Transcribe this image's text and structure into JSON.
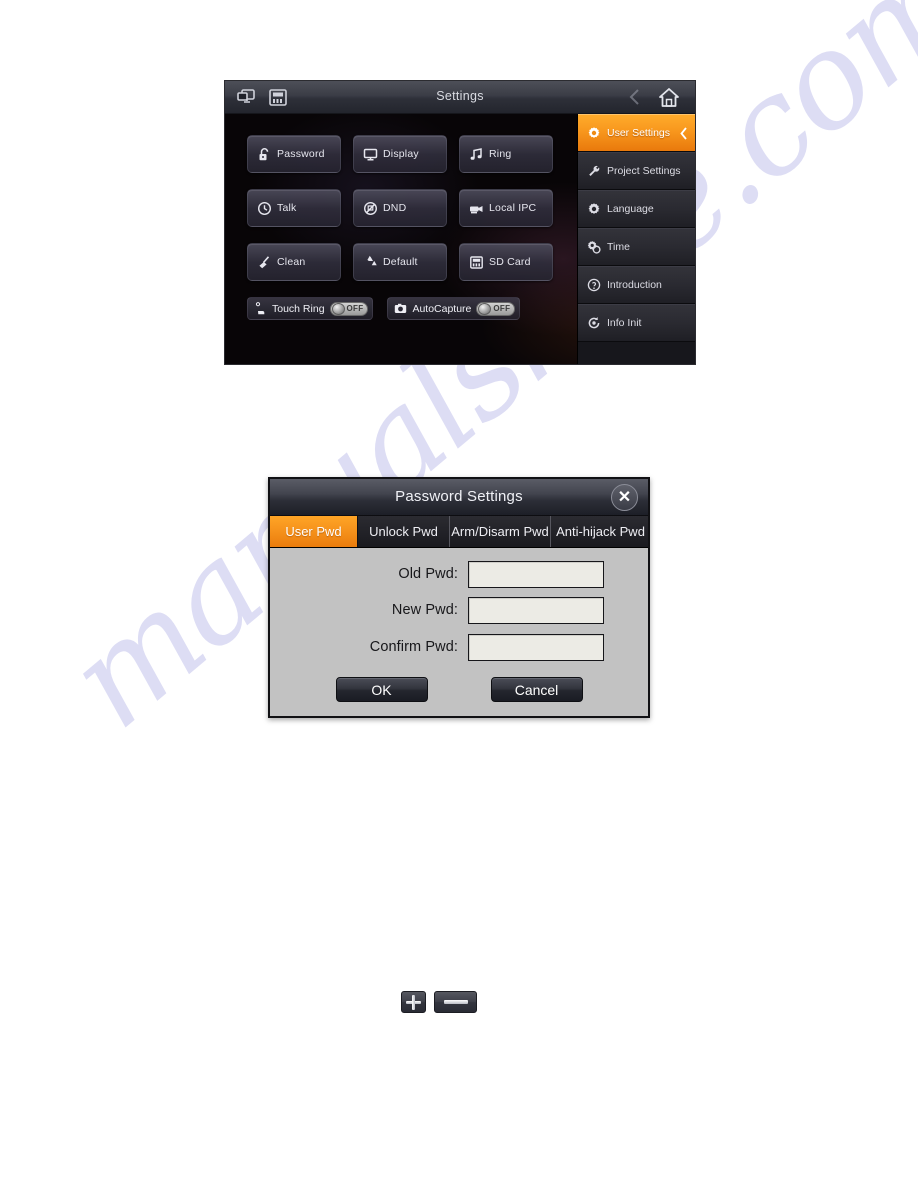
{
  "watermark": {
    "text": "manualshive.com"
  },
  "device": {
    "titlebar": {
      "title": "Settings",
      "left_icons": [
        {
          "name": "multi-screen-icon",
          "label": "Multi Screen"
        },
        {
          "name": "sd-card-icon",
          "label": "SD Card"
        }
      ],
      "home_icon_label": "Home",
      "back_chevron_label": "Back"
    },
    "tiles": [
      [
        {
          "label": "Password",
          "icon": "unlock-padlock-icon"
        },
        {
          "label": "Display",
          "icon": "monitor-icon"
        },
        {
          "label": "Ring",
          "icon": "music-note-icon"
        }
      ],
      [
        {
          "label": "Talk",
          "icon": "clock-icon"
        },
        {
          "label": "DND",
          "icon": "do-not-disturb-icon"
        },
        {
          "label": "Local IPC",
          "icon": "camera-icon"
        }
      ],
      [
        {
          "label": "Clean",
          "icon": "broom-icon"
        },
        {
          "label": "Default",
          "icon": "recycle-icon"
        },
        {
          "label": "SD Card",
          "icon": "sd-card-icon"
        }
      ]
    ],
    "toggles": [
      {
        "label": "Touch Ring",
        "icon": "touch-hand-icon",
        "state": "OFF"
      },
      {
        "label": "AutoCapture",
        "icon": "photo-camera-icon",
        "state": "OFF"
      }
    ],
    "sidebar": {
      "items": [
        {
          "label": "User Settings",
          "icon": "gear-icon",
          "active": true
        },
        {
          "label": "Project Settings",
          "icon": "wrench-icon",
          "active": false
        },
        {
          "label": "Language",
          "icon": "gear-icon",
          "active": false
        },
        {
          "label": "Time",
          "icon": "gears-icon",
          "active": false
        },
        {
          "label": "Introduction",
          "icon": "question-icon",
          "active": false
        },
        {
          "label": "Info Init",
          "icon": "refresh-icon",
          "active": false
        }
      ]
    },
    "colors": {
      "accent": "#f5911b",
      "panel_dark": "#141418",
      "screen_bg": "#080507"
    }
  },
  "dialog": {
    "title": "Password Settings",
    "close_label": "✕",
    "tabs": [
      {
        "label": "User Pwd",
        "active": true
      },
      {
        "label": "Unlock Pwd",
        "active": false
      },
      {
        "label": "Arm/Disarm Pwd",
        "active": false
      },
      {
        "label": "Anti-hijack Pwd",
        "active": false
      }
    ],
    "fields": [
      {
        "label": "Old Pwd:",
        "value": "",
        "placeholder": ""
      },
      {
        "label": "New Pwd:",
        "value": "",
        "placeholder": ""
      },
      {
        "label": "Confirm Pwd:",
        "value": "",
        "placeholder": ""
      }
    ],
    "buttons": {
      "ok": "OK",
      "cancel": "Cancel"
    },
    "colors": {
      "accent": "#f5911b",
      "body_bg": "#c2c2c2",
      "input_bg": "#ecebe5"
    }
  },
  "stepper": {
    "plus_label": "+",
    "minus_label": "−"
  }
}
